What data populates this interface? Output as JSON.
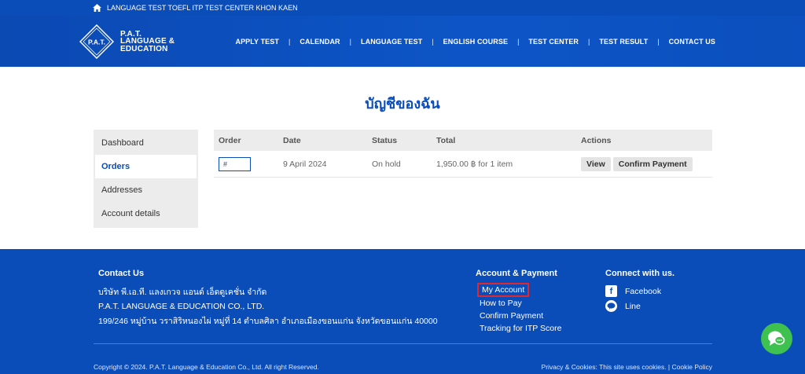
{
  "topbar": {
    "text": "LANGUAGE TEST TOEFL ITP TEST CENTER KHON KAEN",
    "icon": "home-icon"
  },
  "brand": {
    "logo_text": "P.A.T.",
    "line1": "P.A.T.",
    "line2": "LANGUAGE &",
    "line3": "EDUCATION"
  },
  "nav": [
    {
      "label": "APPLY TEST"
    },
    {
      "label": "CALENDAR"
    },
    {
      "label": "LANGUAGE TEST"
    },
    {
      "label": "ENGLISH COURSE"
    },
    {
      "label": "TEST CENTER"
    },
    {
      "label": "TEST RESULT"
    },
    {
      "label": "CONTACT US"
    }
  ],
  "page": {
    "title": "บัญชีของฉัน"
  },
  "sidebar": {
    "items": [
      {
        "label": "Dashboard"
      },
      {
        "label": "Orders"
      },
      {
        "label": "Addresses"
      },
      {
        "label": "Account details"
      }
    ],
    "active": "Orders"
  },
  "orders": {
    "headers": {
      "order": "Order",
      "date": "Date",
      "status": "Status",
      "total": "Total",
      "actions": "Actions"
    },
    "rows": [
      {
        "order": "#",
        "date": "9 April 2024",
        "status": "On hold",
        "total": "1,950.00 ฿ for 1 item",
        "view": "View",
        "confirm": "Confirm Payment"
      }
    ]
  },
  "footer": {
    "contact": {
      "title": "Contact Us",
      "line1": "บริษัท พี.เอ.ที. แลงเกวจ แอนด์ เอ็ดดูเคชั่น จำกัด",
      "line2": "P.A.T. LANGUAGE & EDUCATION CO., LTD.",
      "line3": "199/246 หมู่บ้าน วราสิริหนองไผ่ หมู่ที่ 14 ตำบลศิลา อำเภอเมืองขอนแก่น จังหวัดขอนแก่น 40000"
    },
    "account": {
      "title": "Account & Payment",
      "links": [
        "My Account",
        "How to Pay",
        "Confirm Payment",
        "Tracking for ITP Score"
      ]
    },
    "connect": {
      "title": "Connect with us.",
      "facebook": "Facebook",
      "line": "Line"
    },
    "copyright": "Copyright © 2024. P.A.T. Language & Education Co., Ltd.  All right Reserved.",
    "policy": "Privacy & Cookies: This site uses cookies. | Cookie Policy"
  },
  "colors": {
    "primary": "#0a4db8",
    "highlight": "#e0282e",
    "chat": "#3ec14e"
  }
}
